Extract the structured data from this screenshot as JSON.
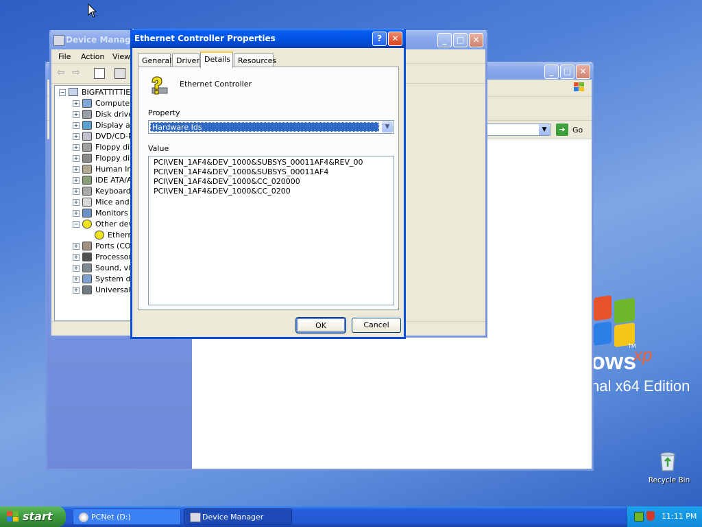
{
  "desktop": {
    "brand_word": "ows",
    "brand_sup": "xp",
    "edition": "nal x64 Edition",
    "tm": "TM",
    "recycle_bin_label": "Recycle Bin"
  },
  "device_manager": {
    "title": "Device Manage",
    "menu": [
      "File",
      "Action",
      "View"
    ],
    "tree_root": "BIGFATTITTIES",
    "tree_items": [
      {
        "label": "Computer",
        "icon": "computer-icon"
      },
      {
        "label": "Disk drives",
        "icon": "disk-drive-icon"
      },
      {
        "label": "Display ada",
        "icon": "display-adapter-icon"
      },
      {
        "label": "DVD/CD-RO",
        "icon": "cdrom-icon"
      },
      {
        "label": "Floppy disk",
        "icon": "floppy-icon"
      },
      {
        "label": "Floppy disk",
        "icon": "floppy-drive-icon"
      },
      {
        "label": "Human Inte",
        "icon": "hid-icon"
      },
      {
        "label": "IDE ATA/AT",
        "icon": "ide-icon"
      },
      {
        "label": "Keyboards",
        "icon": "keyboard-icon"
      },
      {
        "label": "Mice and ot",
        "icon": "mouse-icon"
      },
      {
        "label": "Monitors",
        "icon": "monitor-icon"
      },
      {
        "label": "Other devic",
        "icon": "unknown-device-icon",
        "expanded": true
      },
      {
        "label": "Etherne",
        "icon": "unknown-device-icon",
        "child": true
      },
      {
        "label": "Ports (COM",
        "icon": "port-icon"
      },
      {
        "label": "Processors",
        "icon": "cpu-icon"
      },
      {
        "label": "Sound, vide",
        "icon": "sound-icon"
      },
      {
        "label": "System dev",
        "icon": "system-device-icon"
      },
      {
        "label": "Universal S",
        "icon": "usb-icon"
      }
    ]
  },
  "explorer": {
    "go_label": "Go"
  },
  "dialog": {
    "title": "Ethernet Controller Properties",
    "tabs": [
      "General",
      "Driver",
      "Details",
      "Resources"
    ],
    "active_tab": "Details",
    "device_name": "Ethernet Controller",
    "property_label": "Property",
    "property_value": "Hardware Ids",
    "value_label": "Value",
    "values": [
      "PCI\\VEN_1AF4&DEV_1000&SUBSYS_00011AF4&REV_00",
      "PCI\\VEN_1AF4&DEV_1000&SUBSYS_00011AF4",
      "PCI\\VEN_1AF4&DEV_1000&CC_020000",
      "PCI\\VEN_1AF4&DEV_1000&CC_0200"
    ],
    "ok_label": "OK",
    "cancel_label": "Cancel",
    "help_glyph": "?",
    "close_glyph": "✕"
  },
  "taskbar": {
    "start_label": "start",
    "buttons": [
      {
        "label": "PCNet (D:)",
        "icon": "cd-drive-icon"
      },
      {
        "label": "Device Manager",
        "icon": "device-manager-icon"
      }
    ],
    "clock": "11:11 PM"
  },
  "colors": {
    "title_active": "#0054e3",
    "selection": "#316ac5",
    "start_green": "#3c9a3c"
  }
}
